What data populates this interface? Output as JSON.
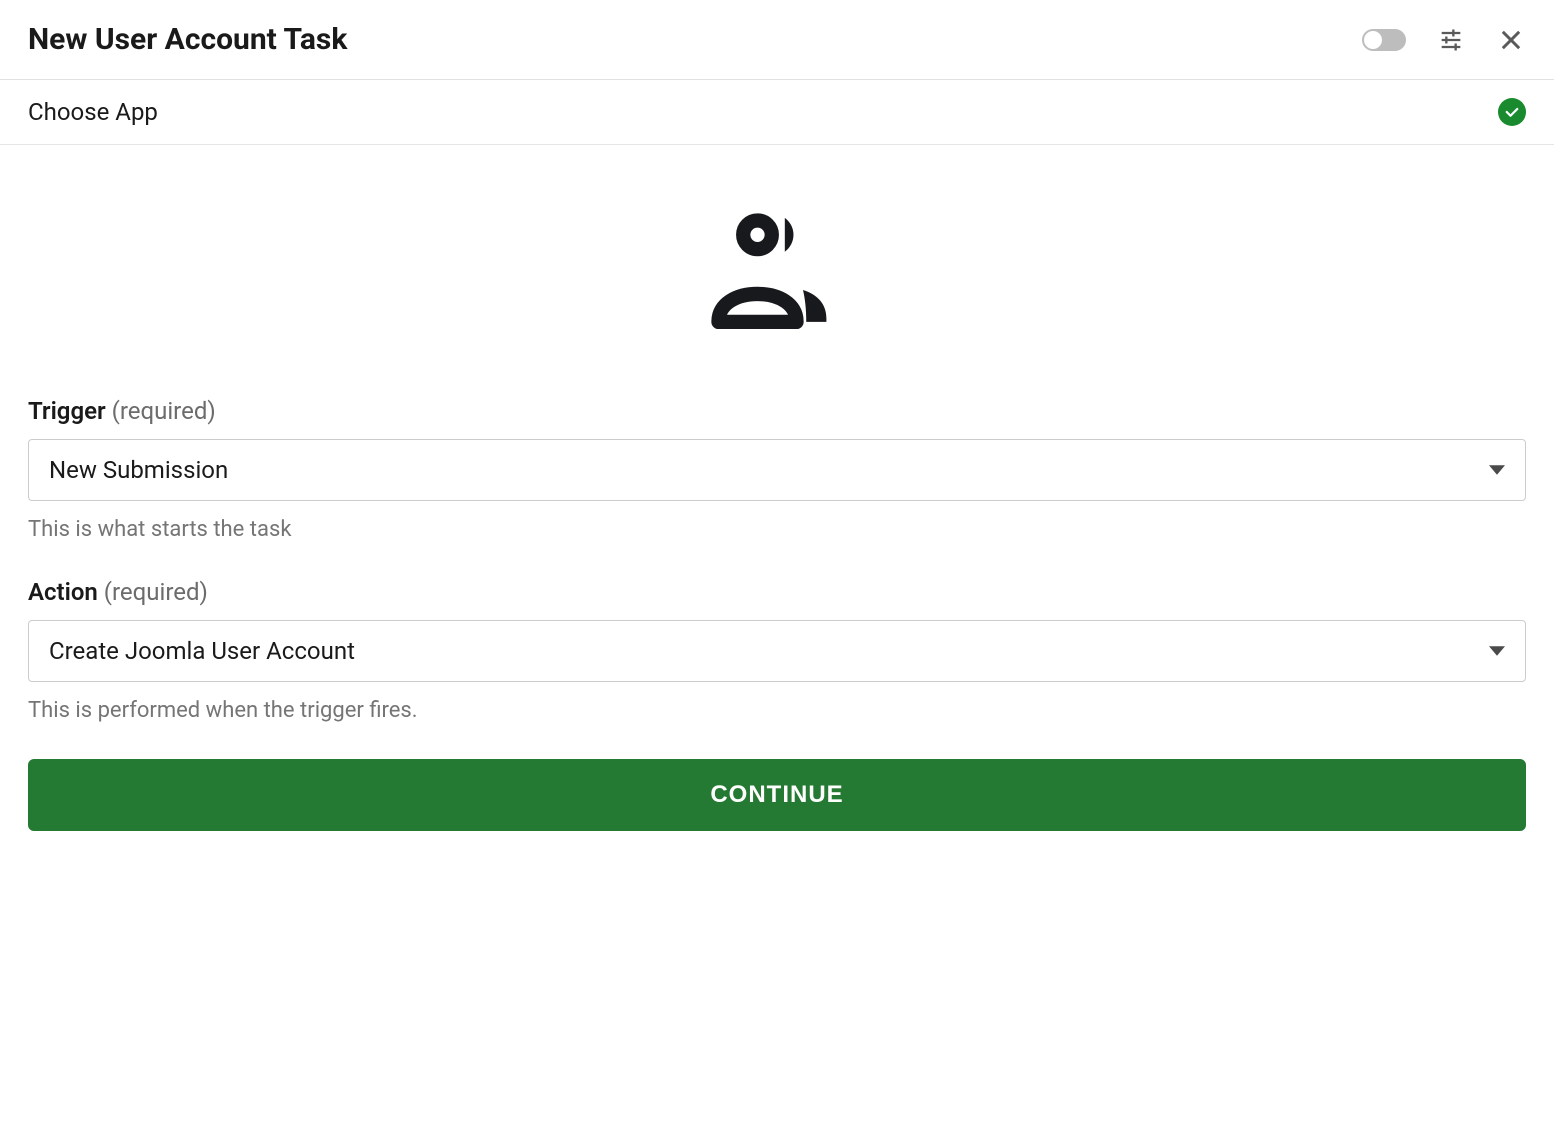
{
  "header": {
    "title": "New User Account Task"
  },
  "section": {
    "title": "Choose App"
  },
  "fields": {
    "trigger": {
      "label": "Trigger",
      "required_text": "(required)",
      "value": "New Submission",
      "help": "This is what starts the task"
    },
    "action": {
      "label": "Action",
      "required_text": "(required)",
      "value": "Create Joomla User Account",
      "help": "This is performed when the trigger fires."
    }
  },
  "buttons": {
    "continue": "CONTINUE"
  }
}
